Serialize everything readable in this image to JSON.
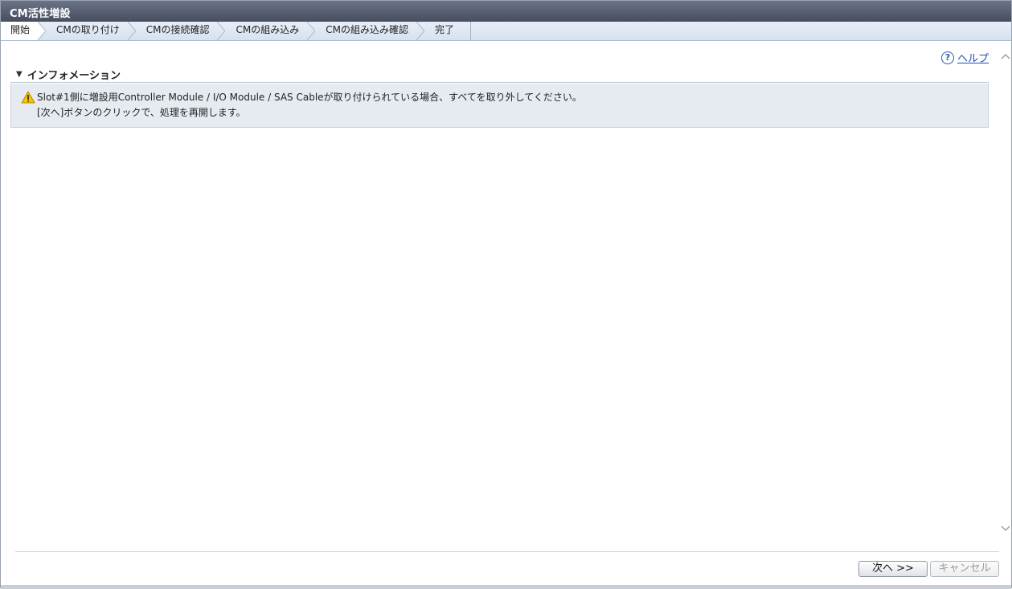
{
  "window": {
    "title": "CM活性増設"
  },
  "steps": [
    {
      "label": "開始",
      "current": true
    },
    {
      "label": "CMの取り付け",
      "current": false
    },
    {
      "label": "CMの接続確認",
      "current": false
    },
    {
      "label": "CMの組み込み",
      "current": false
    },
    {
      "label": "CMの組み込み確認",
      "current": false
    },
    {
      "label": "完了",
      "current": false
    }
  ],
  "help": {
    "icon": "?",
    "label": "ヘルプ"
  },
  "information": {
    "heading": "インフォメーション",
    "line1": "Slot#1側に増設用Controller Module / I/O Module / SAS Cableが取り付けられている場合、すべてを取り外してください。",
    "line2": "[次へ]ボタンのクリックで、処理を再開します。"
  },
  "buttons": {
    "next": "次へ >>",
    "cancel": "キャンセル"
  },
  "colors": {
    "titlebar": "#464e5f",
    "steps_bg": "#d6e2f0",
    "info_bg": "#e6ebf1",
    "link": "#1d4fb3",
    "warning": "#f5c400"
  }
}
